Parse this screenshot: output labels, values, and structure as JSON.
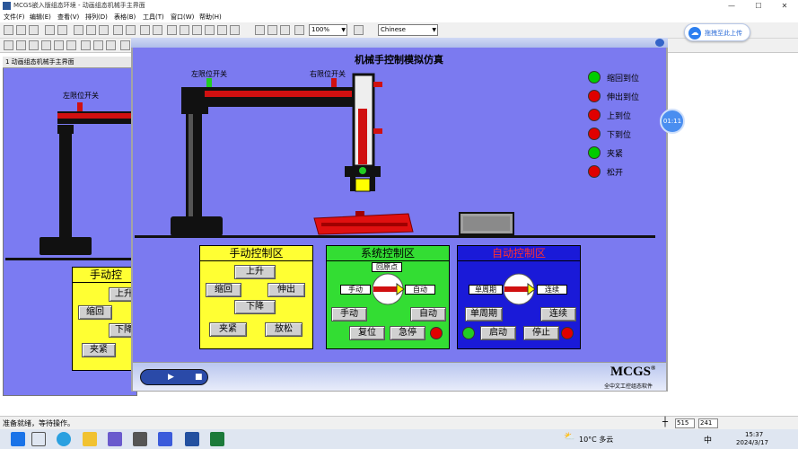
{
  "window": {
    "title": "MCGS嵌入版组态环境 - 动画组态机械手主界面",
    "minimize": "—",
    "maximize": "☐",
    "close": "✕"
  },
  "menu": [
    "文件(F)",
    "编辑(E)",
    "查看(V)",
    "排列(D)",
    "表格(B)",
    "工具(T)",
    "窗口(W)",
    "帮助(H)"
  ],
  "toolbar": {
    "zoom": "100%",
    "language": "Chinese"
  },
  "cloud": {
    "label": "拖拽至此上传"
  },
  "timer_badge": "01:11",
  "bg_window": {
    "title": "1 动画组态机械手主界面",
    "limit_label": "左限位开关",
    "panel_title": "手动控",
    "buttons": [
      "上升",
      "缩回",
      "下降",
      "夹紧"
    ]
  },
  "sim": {
    "title": "机械手控制模拟仿真",
    "left_limit": "左限位开关",
    "right_limit": "右限位开关",
    "indicators": [
      {
        "label": "缩回到位",
        "color": "#00cc00"
      },
      {
        "label": "伸出到位",
        "color": "#e00000"
      },
      {
        "label": "上到位",
        "color": "#e00000"
      },
      {
        "label": "下到位",
        "color": "#e00000"
      },
      {
        "label": "夹紧",
        "color": "#00cc00"
      },
      {
        "label": "松开",
        "color": "#e00000"
      }
    ]
  },
  "manual_panel": {
    "title": "手动控制区",
    "up": "上升",
    "retract": "缩回",
    "extend": "伸出",
    "down": "下降",
    "clamp": "夹紧",
    "release": "放松"
  },
  "system_panel": {
    "title": "系统控制区",
    "origin": "回原点",
    "manual_tag": "手动",
    "auto_tag": "自动",
    "manual_btn": "手动",
    "auto_btn": "自动",
    "reset_btn": "复位",
    "estop_btn": "急停"
  },
  "auto_panel": {
    "title": "自动控制区",
    "single_tag": "单周期",
    "continuous_tag": "连续",
    "single_btn": "单周期",
    "continuous_btn": "连续",
    "start_btn": "启动",
    "stop_btn": "停止"
  },
  "brand": {
    "name": "MCGS",
    "reg": "®",
    "sub": "全中文工控组态软件"
  },
  "status": {
    "text": "准备就绪，等待操作。",
    "x": "515",
    "y": "241"
  },
  "taskbar": {
    "weather": "10°C 多云",
    "ime": "中",
    "time": "15:37",
    "date": "2024/3/17"
  }
}
